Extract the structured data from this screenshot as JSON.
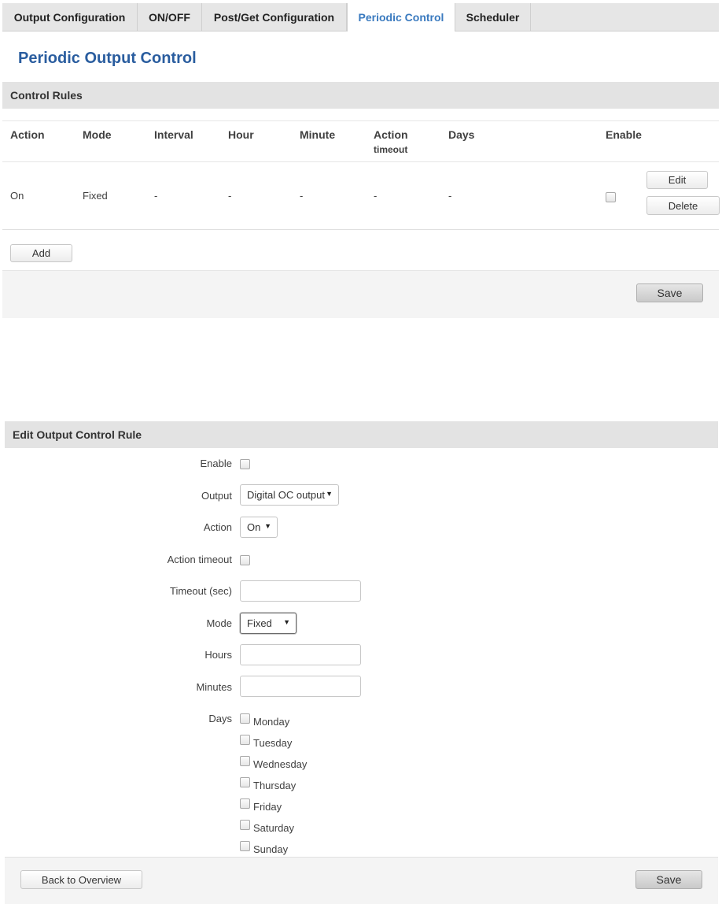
{
  "tabs": [
    {
      "label": "Output Configuration"
    },
    {
      "label": "ON/OFF"
    },
    {
      "label": "Post/Get Configuration"
    },
    {
      "label": "Periodic Control",
      "active": true
    },
    {
      "label": "Scheduler"
    }
  ],
  "page_title": "Periodic Output Control",
  "control_rules": {
    "title": "Control Rules",
    "columns": {
      "action": "Action",
      "mode": "Mode",
      "interval": "Interval",
      "hour": "Hour",
      "minute": "Minute",
      "action_timeout_line1": "Action",
      "action_timeout_line2": "timeout",
      "days": "Days",
      "enable": "Enable"
    },
    "rows": [
      {
        "action": "On",
        "mode": "Fixed",
        "interval": "-",
        "hour": "-",
        "minute": "-",
        "action_timeout": "-",
        "days": "-",
        "enabled": false
      }
    ],
    "edit_label": "Edit",
    "delete_label": "Delete",
    "add_label": "Add",
    "save_label": "Save"
  },
  "edit_rule": {
    "title": "Edit Output Control Rule",
    "enable_label": "Enable",
    "enabled": false,
    "output_label": "Output",
    "output_value": "Digital OC output",
    "action_label": "Action",
    "action_value": "On",
    "action_timeout_label": "Action timeout",
    "action_timeout_checked": false,
    "timeout_label": "Timeout (sec)",
    "timeout_value": "",
    "mode_label": "Mode",
    "mode_value": "Fixed",
    "hours_label": "Hours",
    "hours_value": "",
    "minutes_label": "Minutes",
    "minutes_value": "",
    "days_label": "Days",
    "days": [
      "Monday",
      "Tuesday",
      "Wednesday",
      "Thursday",
      "Friday",
      "Saturday",
      "Sunday"
    ],
    "back_label": "Back to Overview",
    "save_label": "Save"
  },
  "icons": {
    "select_arrow": "caret-down-icon"
  }
}
